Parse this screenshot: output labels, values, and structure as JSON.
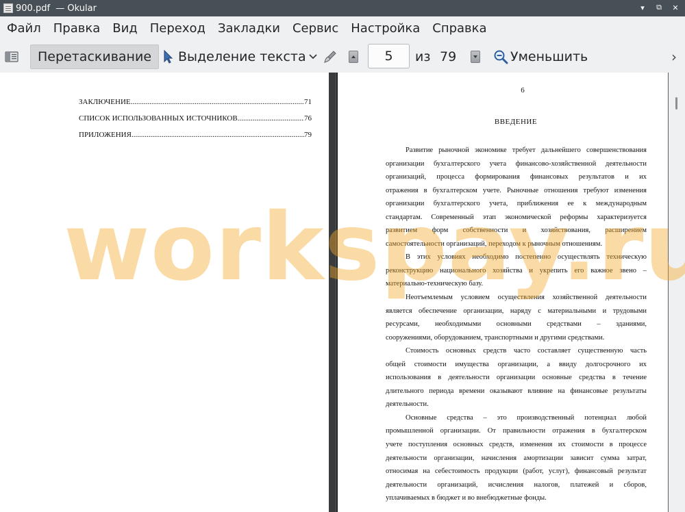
{
  "window": {
    "title": "900.pdf  — Okular",
    "controls": [
      "▾",
      "⧉",
      "✕"
    ]
  },
  "menu": [
    "Файл",
    "Правка",
    "Вид",
    "Переход",
    "Закладки",
    "Сервис",
    "Настройка",
    "Справка"
  ],
  "toolbar": {
    "drag_label": "Перетаскивание",
    "select_label": "Выделение текста",
    "page_value": "5",
    "of_label": "из",
    "total_pages": "79",
    "zoom_label": "Уменьшить",
    "more_icon": "›"
  },
  "left_page": {
    "toc": [
      {
        "title": "ЗАКЛЮЧЕНИЕ ",
        "page": "71"
      },
      {
        "title": "СПИСОК ИСПОЛЬЗОВАННЫХ ИСТОЧНИКОВ ",
        "page": "76"
      },
      {
        "title": "ПРИЛОЖЕНИЯ ",
        "page": "79"
      }
    ]
  },
  "right_page": {
    "page_number": "6",
    "heading": "ВВЕДЕНИЕ",
    "lines": [
      "Развитие рыночной экономике требует дальнейшего совершенствования",
      "организации бухгалтерского учета финансово-хозяйственной деятельности",
      "организаций, процесса формирования финансовых результатов и их",
      "отражения в бухгалтерском учете. Рыночные отношения требуют изменения",
      "организации бухгалтерского учета, приближения ее к международным",
      "стандартам. Современный этап экономической реформы характеризуется",
      "развитием форм собственности и хозяйствования, расширением",
      "самостоятельности организаций, переходом к рыночным отношениям.",
      "В этих условиях необходимо постепенно осуществлять техническую",
      "реконструкцию национального хозяйства и укрепить его важное звено –",
      "материально-техническую базу.",
      "Неотъемлемым условием осуществления хозяйственной деятельности",
      "является обеспечение организации, наряду с материальными и трудовыми",
      "ресурсами, необходимыми основными средствами – зданиями,",
      "сооружениями, оборудованием, транспортными и другими средствами.",
      "Стоимость основных средств часто составляет существенную часть",
      "общей стоимости имущества организации, а ввиду долгосрочного их",
      "использования в деятельности организации основные средства в течение",
      "длительного периода времени оказывают влияние на финансовые результаты",
      "деятельности.",
      "Основные средства – это производственный потенциал любой",
      "промышленной организации. От правильности отражения в бухгалтерском",
      "учете поступления основных средств, изменения их стоимости в процессе",
      "деятельности организации, начисления амортизации зависит сумма затрат,",
      "относимая на себестоимость продукции (работ, услуг), финансовый результат",
      "деятельности организаций, исчисления налогов, платежей и сборов,",
      "уплачиваемых в бюджет и во внебюджетные фонды."
    ]
  },
  "watermark": "workspay.ru"
}
